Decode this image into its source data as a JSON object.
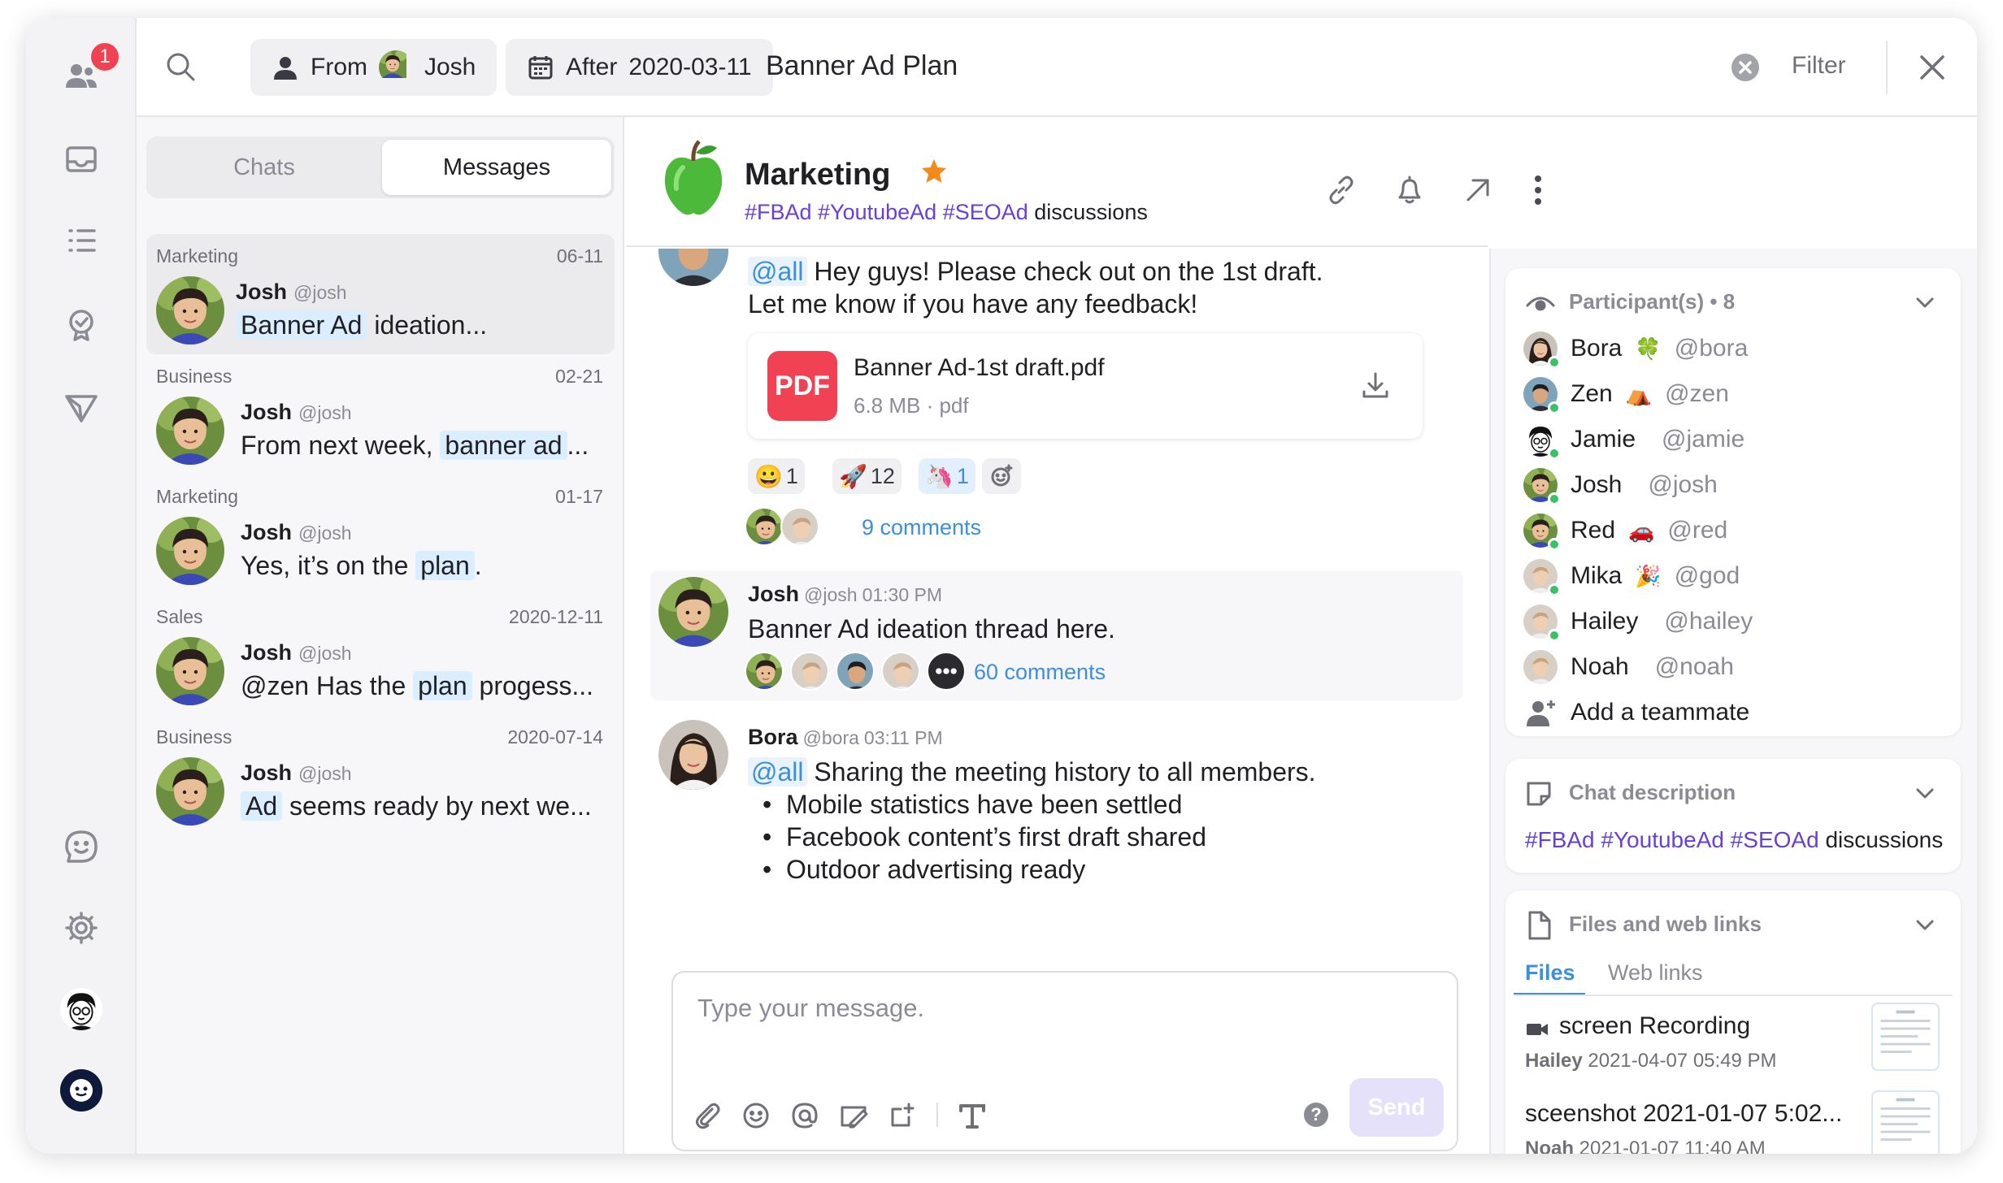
{
  "sidebar": {
    "notifications_badge": "1"
  },
  "search": {
    "from_label": "From",
    "from_user": "Josh",
    "after_label": "After",
    "after_date": "2020-03-11",
    "query": "Banner Ad Plan",
    "filter_label": "Filter"
  },
  "list": {
    "tabs": [
      "Chats",
      "Messages"
    ],
    "items": [
      {
        "group": "Marketing",
        "date": "06-11",
        "name": "Josh",
        "handle": "@josh",
        "pre": "",
        "hl": "Banner Ad",
        "post": " ideation..."
      },
      {
        "group": "Business",
        "date": "02-21",
        "name": "Josh",
        "handle": "@josh",
        "pre": "From next week, ",
        "hl": "banner ad",
        "post": "..."
      },
      {
        "group": "Marketing",
        "date": "01-17",
        "name": "Josh",
        "handle": "@josh",
        "pre": "Yes, it’s on the ",
        "hl": "plan",
        "post": "."
      },
      {
        "group": "Sales",
        "date": "2020-12-11",
        "name": "Josh",
        "handle": "@josh",
        "pre": "@zen Has the ",
        "hl": "plan",
        "post": " progess..."
      },
      {
        "group": "Business",
        "date": "2020-07-14",
        "name": "Josh",
        "handle": "@josh",
        "pre": "",
        "hl": "Ad",
        "post": " seems ready by next we..."
      }
    ]
  },
  "chat": {
    "title": "Marketing",
    "subtitle_tags": "#FBAd #YoutubeAd #SEOAd",
    "subtitle_rest": " discussions",
    "msg1": {
      "mention": "@all",
      "line1": " Hey guys! Please check out on the 1st draft.",
      "line2": "Let me know if you have any feedback!",
      "file_name": "Banner Ad-1st draft.pdf",
      "file_meta": "6.8 MB · pdf",
      "file_badge": "PDF",
      "reactions": [
        "1",
        "12",
        "1"
      ],
      "comments": "9 comments"
    },
    "msg2": {
      "name": "Josh",
      "handle": "@josh",
      "time": "01:30 PM",
      "text": "Banner Ad ideation thread here.",
      "comments": "60 comments"
    },
    "msg3": {
      "name": "Bora",
      "handle": "@bora",
      "time": "03:11 PM",
      "mention": "@all",
      "text": " Sharing the meeting history to all members.",
      "bullets": [
        "Mobile statistics have been settled",
        "Facebook content’s first draft shared",
        "Outdoor advertising ready"
      ]
    },
    "composer_placeholder": "Type your message.",
    "send_label": "Send"
  },
  "panel": {
    "participants_title": "Participant(s) • 8",
    "participants": [
      {
        "name": "Bora",
        "emoji": "🍀",
        "handle": "@bora"
      },
      {
        "name": "Zen",
        "emoji": "⛺",
        "handle": "@zen"
      },
      {
        "name": "Jamie",
        "emoji": "",
        "handle": "@jamie"
      },
      {
        "name": "Josh",
        "emoji": "",
        "handle": "@josh"
      },
      {
        "name": "Red",
        "emoji": "🚗",
        "handle": "@red"
      },
      {
        "name": "Mika",
        "emoji": "🎉",
        "handle": "@god"
      },
      {
        "name": "Hailey",
        "emoji": "",
        "handle": "@hailey"
      },
      {
        "name": "Noah",
        "emoji": "",
        "handle": "@noah"
      }
    ],
    "add_teammate": "Add a teammate",
    "desc_title": "Chat description",
    "desc_tags": "#FBAd #YoutubeAd #SEOAd",
    "desc_rest": " discussions",
    "files_title": "Files and web links",
    "files_tabs": [
      "Files",
      "Web links"
    ],
    "files": [
      {
        "name": "screen Recording",
        "owner": "Hailey",
        "date": "2021-04-07 05:49 PM"
      },
      {
        "name": "sceenshot 2021-01-07 5:02...",
        "owner": "Noah",
        "date": "2021-01-07 11:40 AM"
      }
    ]
  },
  "colors": {
    "accent": "#3b8fdc",
    "hashtag": "#6a3fd8",
    "badge": "#f04252",
    "pdf": "#f04252",
    "online": "#3ac166"
  }
}
